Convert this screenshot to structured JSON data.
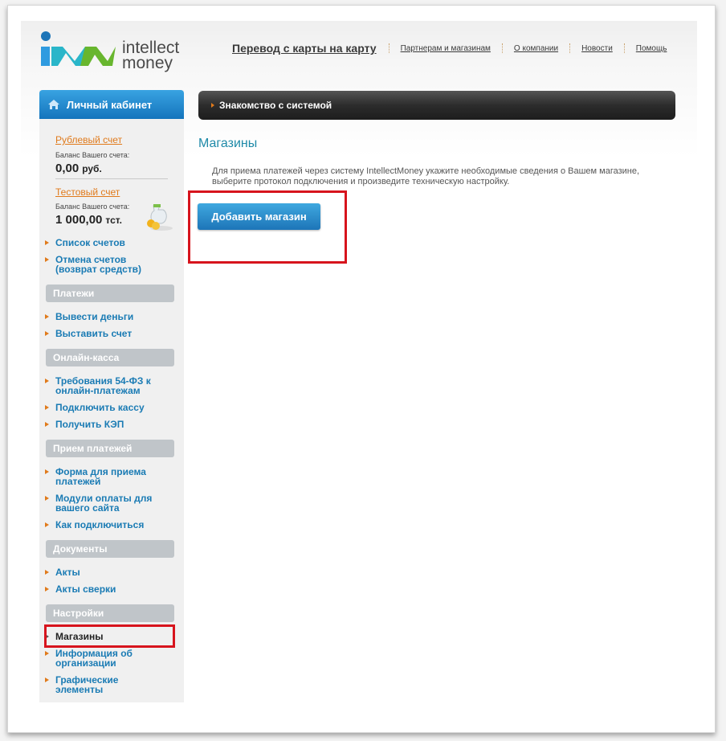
{
  "logo": {
    "line1": "intellect",
    "line2": "money"
  },
  "nav": {
    "main": "Перевод с карты на карту",
    "links": [
      "Партнерам и магазинам",
      "О компании",
      "Новости",
      "Помощь"
    ]
  },
  "sidebar": {
    "cabinet": "Личный кабинет",
    "rub_account": {
      "link": "Рублевый счет",
      "label": "Баланс Вашего счета:",
      "value": "0,00",
      "unit": "руб."
    },
    "test_account": {
      "link": "Тестовый счет",
      "label": "Баланс Вашего счета:",
      "value": "1 000,00",
      "unit": "тст."
    },
    "account_items": [
      "Список счетов",
      "Отмена счетов\n(возврат средств)"
    ],
    "sections": [
      {
        "title": "Платежи",
        "items": [
          "Вывести деньги",
          "Выставить счет"
        ]
      },
      {
        "title": "Онлайн-касса",
        "items": [
          "Требования 54-ФЗ к онлайн-платежам",
          "Подключить кассу",
          "Получить КЭП"
        ]
      },
      {
        "title": "Прием платежей",
        "items": [
          "Форма для приема платежей",
          "Модули оплаты для вашего сайта",
          "Как подключиться"
        ]
      },
      {
        "title": "Документы",
        "items": [
          "Акты",
          "Акты сверки"
        ]
      },
      {
        "title": "Настройки",
        "items": [
          "Магазины",
          "Информация об организации",
          "Графические элементы"
        ]
      }
    ]
  },
  "content": {
    "bar": "Знакомство с системой",
    "title": "Магазины",
    "description": "Для приема платежей через систему IntellectMoney укажите необходимые сведения о Вашем магазине, выберите протокол подключения и произведите техническую настройку.",
    "button": "Добавить магазин"
  },
  "colors": {
    "accent_blue": "#1d75b8",
    "link_orange": "#e07a1b",
    "highlight_red": "#d7141d"
  }
}
